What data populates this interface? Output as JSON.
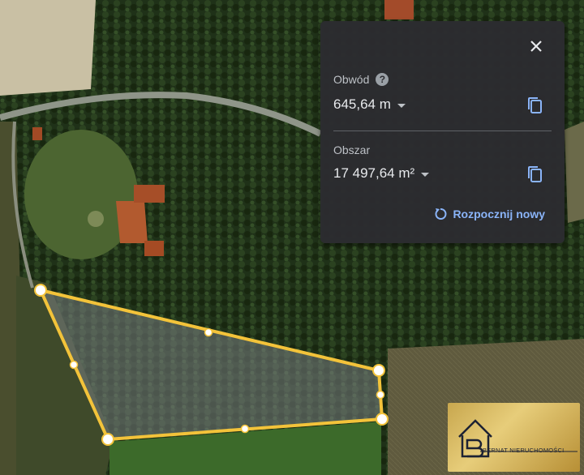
{
  "panel": {
    "perimeter_label": "Obwód",
    "perimeter_value": "645,64 m",
    "area_label": "Obszar",
    "area_value": "17 497,64 m²",
    "restart_label": "Rozpocznij nowy"
  },
  "logo": {
    "text": "BERNAT NIERUCHOMOŚCI"
  },
  "colors": {
    "accent": "#8ab4f8",
    "polygon_stroke": "#f3c33a",
    "panel_bg": "#2c2c30"
  },
  "icons": [
    "close-icon",
    "help-icon",
    "chevron-down-icon",
    "copy-icon",
    "restart-icon",
    "house-logo-icon"
  ]
}
